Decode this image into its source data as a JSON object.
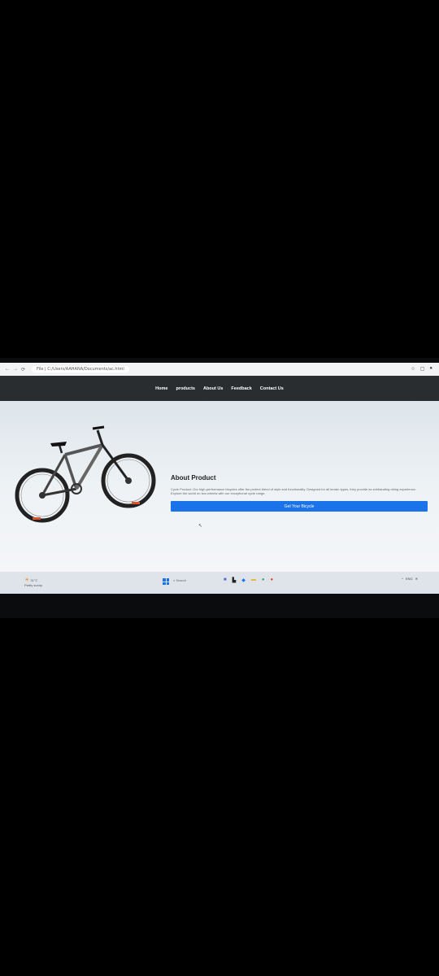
{
  "browser": {
    "url": "File | C:/Users/AAHANA/Documents/ac.html",
    "nav_back": "←",
    "nav_forward": "→",
    "nav_reload": "⟳"
  },
  "nav": {
    "items": [
      {
        "label": "Home"
      },
      {
        "label": "products"
      },
      {
        "label": "About Us"
      },
      {
        "label": "Feedback"
      },
      {
        "label": "Contact Us"
      }
    ]
  },
  "main": {
    "heading": "About Product",
    "description": "Cycle Product: Our high-performance bicycles offer the perfect blend of style and functionality. Designed for all terrain types, they provide an exhilarating riding experience. Explore the world on two wheels with our exceptional cycle range.",
    "cta_label": "Get Your Bicycle",
    "cursor": "↖"
  },
  "taskbar": {
    "weather_temp": "31°C",
    "weather_desc": "Partly sunny",
    "search_placeholder": "Search",
    "apps": [
      "teams-icon",
      "file-explorer-icon",
      "vscode-icon",
      "folder-icon",
      "chrome-icon",
      "chrome-icon"
    ],
    "tray_lang": "ENG"
  },
  "colors": {
    "nav_bg": "#2a2d30",
    "cta_bg": "#1a73e8",
    "accent_red": "#d9532b"
  }
}
